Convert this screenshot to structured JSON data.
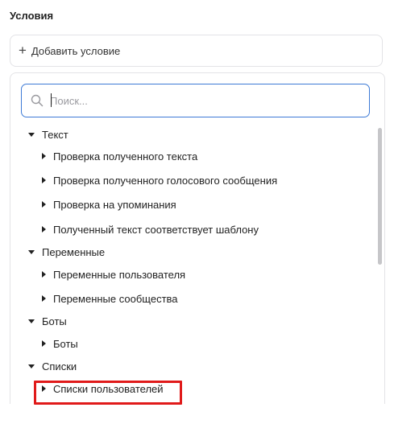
{
  "section": {
    "title": "Условия",
    "add_label": "Добавить условие"
  },
  "search": {
    "placeholder": "Поиск..."
  },
  "tree": {
    "groups": [
      {
        "label": "Текст",
        "items": [
          "Проверка полученного текста",
          "Проверка полученного голосового сообщения",
          "Проверка на упоминания",
          "Полученный текст соответствует шаблону"
        ]
      },
      {
        "label": "Переменные",
        "items": [
          "Переменные пользователя",
          "Переменные сообщества"
        ]
      },
      {
        "label": "Боты",
        "items": [
          "Боты"
        ]
      },
      {
        "label": "Списки",
        "items": [
          "Списки пользователей"
        ]
      }
    ]
  },
  "colors": {
    "focus_border": "#3d7ad6",
    "highlight_border": "#e01a1a"
  },
  "icons": {
    "add": "plus-icon",
    "search": "search-icon",
    "expanded": "caret-down-icon",
    "collapsed": "caret-right-icon"
  }
}
